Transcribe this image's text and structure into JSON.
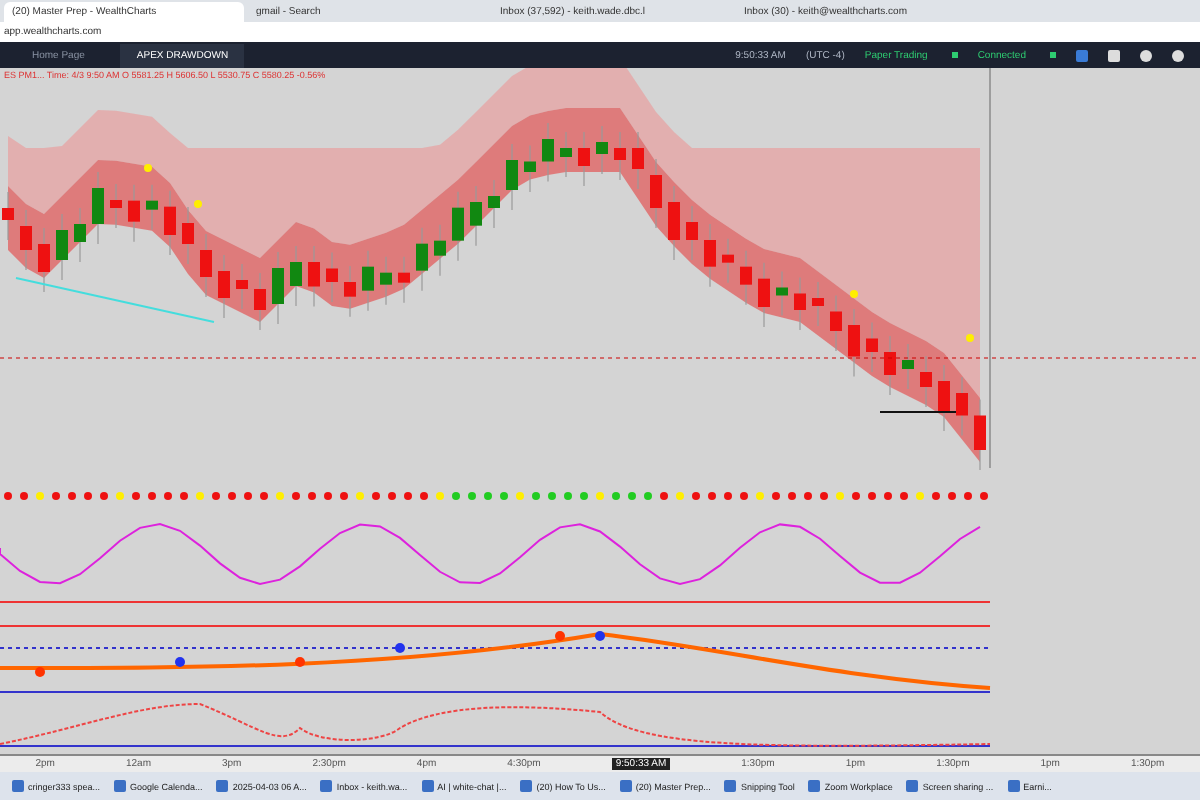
{
  "browser_tabs": [
    {
      "title": "(20) Master Prep - WealthCharts",
      "selected": true
    },
    {
      "title": "gmail - Search",
      "selected": false
    },
    {
      "title": "Inbox (37,592) - keith.wade.dbc.l",
      "selected": false
    },
    {
      "title": "Inbox (30) - keith@wealthcharts.com",
      "selected": false
    }
  ],
  "address": "app.wealthcharts.com",
  "app_tabs": [
    {
      "label": "Home Page",
      "selected": false
    },
    {
      "label": "APEX DRAWDOWN",
      "selected": true
    }
  ],
  "status": {
    "time": "9:50:33 AM",
    "timezone": "(UTC -4)",
    "items": [
      {
        "label": "Paper Trading",
        "color": "#2ecc71"
      },
      {
        "label": "Connected",
        "color": "#2ecc71"
      }
    ]
  },
  "chart": {
    "header": "ES PM1... Time: 4/3 9:50 AM O 5581.25 H 5606.50 L 5530.75 C 5580.25 -0.56%",
    "time_labels": [
      "2pm",
      "12am",
      "3pm",
      "2:30pm",
      "4pm",
      "4:30pm",
      "1:30pm",
      "1pm",
      "1:30pm",
      "1pm",
      "1:30pm"
    ],
    "crosshair_label": "9:50:33 AM"
  },
  "taskbar": [
    "cringer333 spea...",
    "Google Calenda...",
    "2025-04-03 06 A...",
    "Inbox - keith.wa...",
    "AI | white-chat |...",
    "(20) How To Us...",
    "(20) Master Prep...",
    "Snipping Tool",
    "Zoom Workplace",
    "Screen sharing ...",
    "Earni..."
  ]
}
